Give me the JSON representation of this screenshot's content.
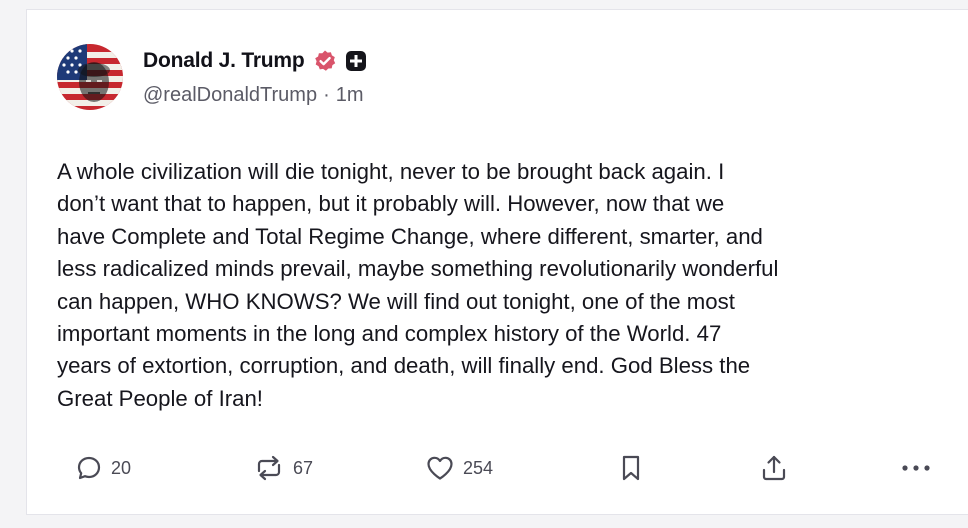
{
  "post": {
    "author": {
      "display_name": "Donald J. Trump",
      "handle": "@realDonaldTrump",
      "verified": true,
      "avatar_icon": "flag-portrait-avatar",
      "badge_icon": "verified-badge-icon",
      "extra_badge_icon": "plus-badge-icon"
    },
    "separator": "·",
    "timestamp": "1m",
    "body": "A whole civilization will die tonight, never to be brought back again. I\ndon’t want that to happen, but it probably will. However, now that we\nhave Complete and Total Regime Change, where different, smarter, and\nless radicalized minds prevail, maybe something revolutionarily wonderful\ncan happen, WHO KNOWS? We will find out tonight, one of the most\nimportant moments in the long and complex history of the World. 47\nyears of extortion, corruption, and death, will finally end. God Bless the\nGreat People of Iran!"
  },
  "actions": {
    "reply": {
      "icon": "reply-icon",
      "count": "20"
    },
    "repost": {
      "icon": "repost-icon",
      "count": "67"
    },
    "like": {
      "icon": "heart-icon",
      "count": "254"
    },
    "bookmark": {
      "icon": "bookmark-icon"
    },
    "share": {
      "icon": "share-icon"
    },
    "more": {
      "icon": "more-icon"
    }
  },
  "colors": {
    "verified_badge": "#d9546b",
    "text_primary": "#16161d",
    "text_secondary": "#5b5b66",
    "icon": "#4a4a55",
    "background": "#f4f4f6",
    "card": "#ffffff"
  }
}
